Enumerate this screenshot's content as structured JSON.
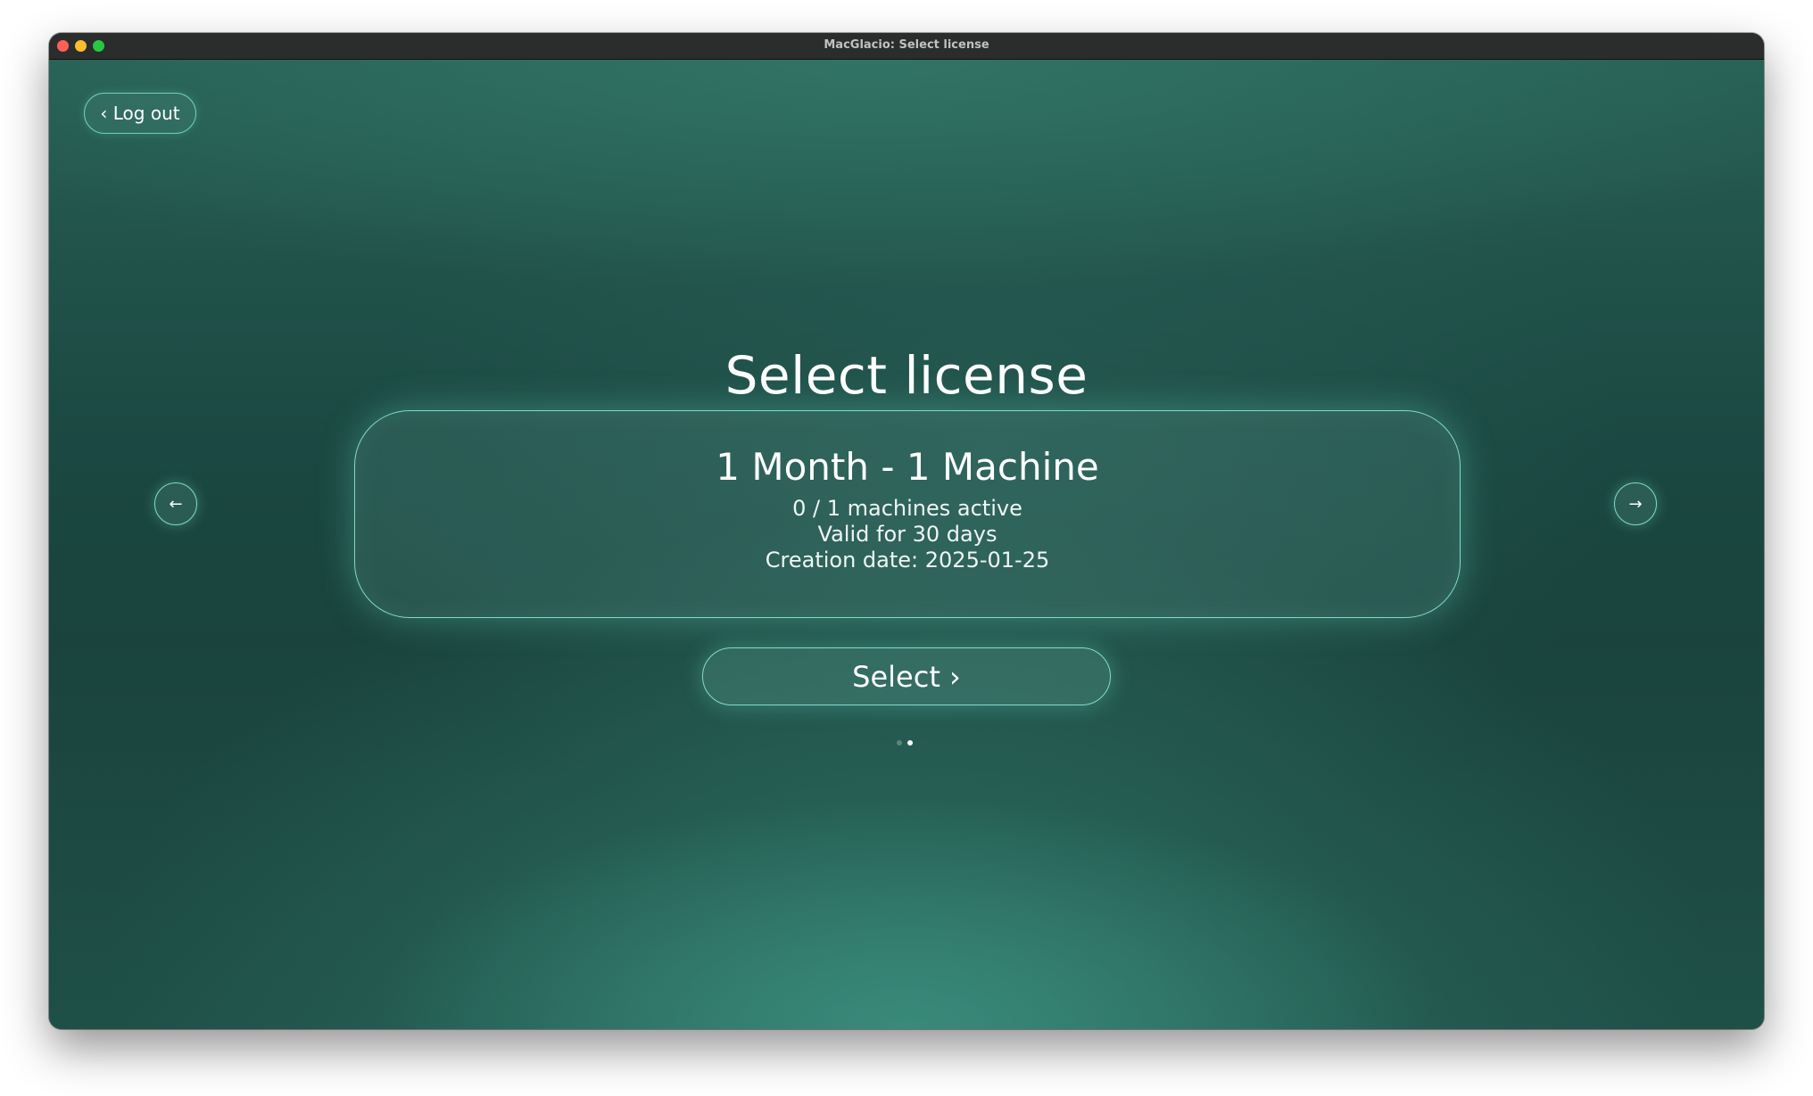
{
  "window": {
    "title": "MacGlacio: Select license"
  },
  "header": {
    "logout_label": "‹ Log out"
  },
  "main": {
    "title": "Select license",
    "license": {
      "name": "1 Month - 1 Machine",
      "machines": "0 / 1 machines active",
      "validity": "Valid for 30 days",
      "creation": "Creation date: 2025-01-25"
    },
    "prev_arrow": "←",
    "next_arrow": "→",
    "select_label": "Select ›",
    "pager": {
      "total": 2,
      "active_index": 1
    }
  },
  "colors": {
    "accent": "#7fdccb",
    "background": "#1a433d"
  }
}
